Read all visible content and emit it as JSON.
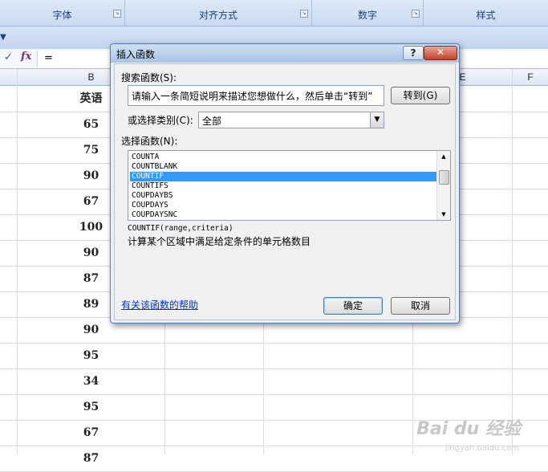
{
  "ribbon": {
    "groups": [
      "字体",
      "对齐方式",
      "数字",
      "样式"
    ]
  },
  "formula_bar": {
    "content": "="
  },
  "columns": [
    "B",
    "E",
    "F"
  ],
  "sheet": {
    "header": "英语",
    "values": [
      "65",
      "75",
      "90",
      "67",
      "100",
      "90",
      "87",
      "89",
      "90",
      "95",
      "34",
      "95",
      "67",
      "87"
    ]
  },
  "dialog": {
    "title": "插入函数",
    "help_btn": "?",
    "close_btn": "✕",
    "search_label": "搜索函数(S):",
    "search_value": "请输入一条简短说明来描述您想做什么，然后单击“转到”",
    "go_btn": "转到(G)",
    "category_label": "或选择类别(C):",
    "category_value": "全部",
    "list_label": "选择函数(N):",
    "functions": [
      "COUNTA",
      "COUNTBLANK",
      "COUNTIF",
      "COUNTIFS",
      "COUPDAYBS",
      "COUPDAYS",
      "COUPDAYSNC"
    ],
    "selected_function": "COUNTIF",
    "signature": "COUNTIF(range,criteria)",
    "description": "计算某个区域中满足给定条件的单元格数目",
    "help_link": "有关该函数的帮助",
    "ok_btn": "确定",
    "cancel_btn": "取消"
  },
  "watermark": {
    "brand": "Bai du 经验",
    "url": "jingyan.baidu.com"
  },
  "colors": {
    "selection": "#3399ff",
    "ribbon_text": "#15428b",
    "link": "#0033cc"
  }
}
